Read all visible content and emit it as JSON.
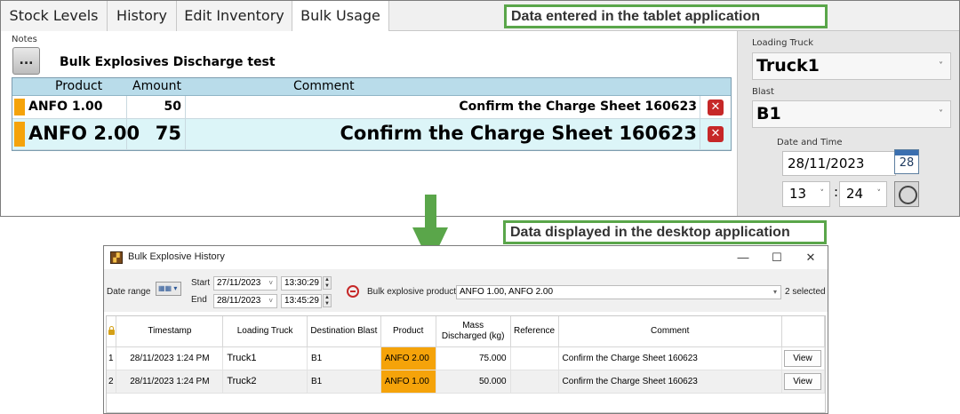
{
  "tablet": {
    "tabs": [
      {
        "label": "Stock Levels"
      },
      {
        "label": "History"
      },
      {
        "label": "Edit Inventory"
      },
      {
        "label": "Bulk Usage"
      }
    ],
    "notes_label": "Notes",
    "notes_button": "...",
    "notes_text": "Bulk Explosives Discharge test",
    "usage_table": {
      "headers": {
        "product": "Product",
        "amount": "Amount",
        "comment": "Comment"
      },
      "rows": [
        {
          "product": "ANFO 1.00",
          "amount": "50",
          "comment": "Confirm the Charge Sheet 160623"
        },
        {
          "product": "ANFO 2.00",
          "amount": "75",
          "comment": "Confirm the Charge Sheet 160623"
        }
      ],
      "row_marker_color": "#f5a30a",
      "delete_icon": "x"
    },
    "side": {
      "loading_truck_label": "Loading Truck",
      "loading_truck_value": "Truck1",
      "blast_label": "Blast",
      "blast_value": "B1",
      "date_time_label": "Date and Time",
      "date_value": "28/11/2023",
      "calendar_icon_text": "28",
      "hour_value": "13",
      "minute_value": "24",
      "time_separator": ":"
    }
  },
  "callouts": {
    "tablet": "Data entered in the tablet application",
    "desktop": "Data displayed in the desktop application"
  },
  "desktop": {
    "window_title": "Bulk Explosive History",
    "window_buttons": {
      "minimize": "—",
      "maximize": "☐",
      "close": "✕"
    },
    "filter": {
      "date_range_label": "Date range",
      "start_label": "Start",
      "start_date": "27/11/2023",
      "start_time": "13:30:29",
      "end_label": "End",
      "end_date": "28/11/2023",
      "end_time": "13:45:29",
      "products_label": "Bulk explosive products",
      "products_value": "ANFO 1.00, ANFO 2.00",
      "selected_count": "2 selected"
    },
    "grid": {
      "headers": {
        "timestamp": "Timestamp",
        "loading_truck": "Loading Truck",
        "destination_blast": "Destination Blast",
        "product": "Product",
        "mass_discharged": "Mass Discharged (kg)",
        "reference": "Reference",
        "comment": "Comment"
      },
      "rows": [
        {
          "index": "1",
          "timestamp": "28/11/2023 1:24 PM",
          "loading_truck": "Truck1",
          "destination_blast": "B1",
          "product": "ANFO 2.00",
          "mass": "75.000",
          "reference": "",
          "comment": "Confirm the Charge Sheet 160623",
          "view": "View"
        },
        {
          "index": "2",
          "timestamp": "28/11/2023 1:24 PM",
          "loading_truck": "Truck2",
          "destination_blast": "B1",
          "product": "ANFO 1.00",
          "mass": "50.000",
          "reference": "",
          "comment": "Confirm the Charge Sheet 160623",
          "view": "View"
        }
      ],
      "product_highlight_color": "#f5a30a"
    }
  },
  "colors": {
    "accent_green": "#5aa64a",
    "header_blue": "#b9dcea",
    "delete_red": "#c62828"
  }
}
